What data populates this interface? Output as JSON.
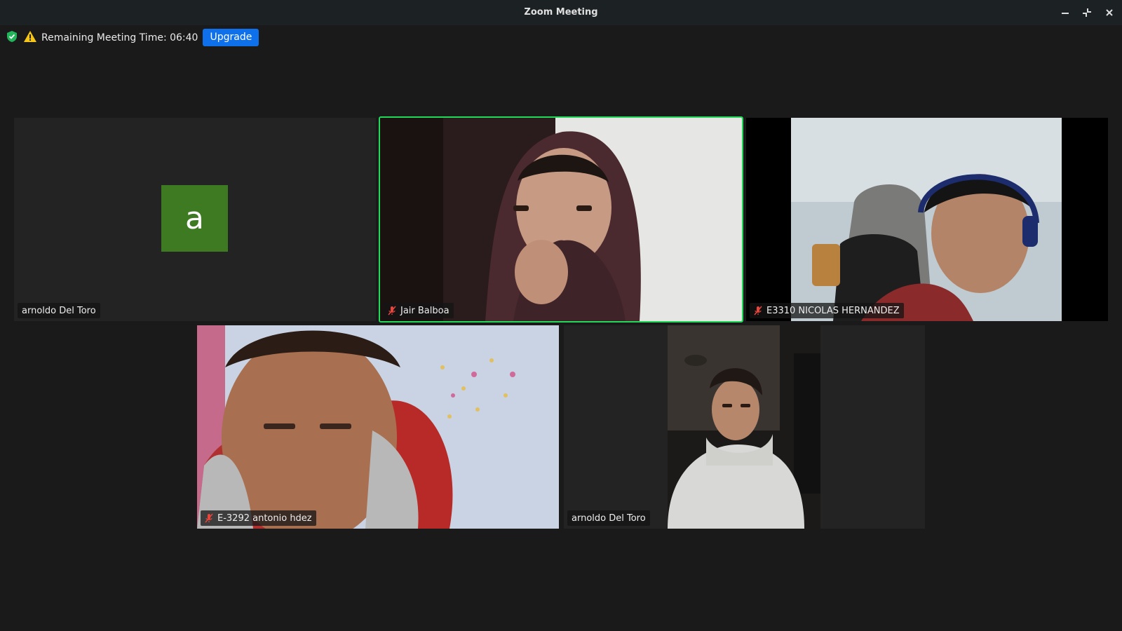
{
  "window": {
    "title": "Zoom Meeting"
  },
  "infobar": {
    "time_label": "Remaining Meeting Time: 06:40",
    "upgrade_label": "Upgrade"
  },
  "participants": [
    {
      "name": "arnoldo Del Toro",
      "avatar_letter": "a",
      "muted": false,
      "video": false
    },
    {
      "name": "Jair Balboa",
      "muted": true,
      "video": true,
      "active_speaker": true
    },
    {
      "name": "E3310 NICOLAS HERNANDEZ",
      "muted": true,
      "video": true
    },
    {
      "name": "E-3292 antonio hdez",
      "muted": true,
      "video": true
    },
    {
      "name": "arnoldo Del Toro",
      "muted": false,
      "video": true
    }
  ],
  "colors": {
    "active_border": "#23d959",
    "upgrade_bg": "#0e71eb",
    "avatar_bg": "#3e7a22",
    "muted_icon": "#e8453c"
  }
}
